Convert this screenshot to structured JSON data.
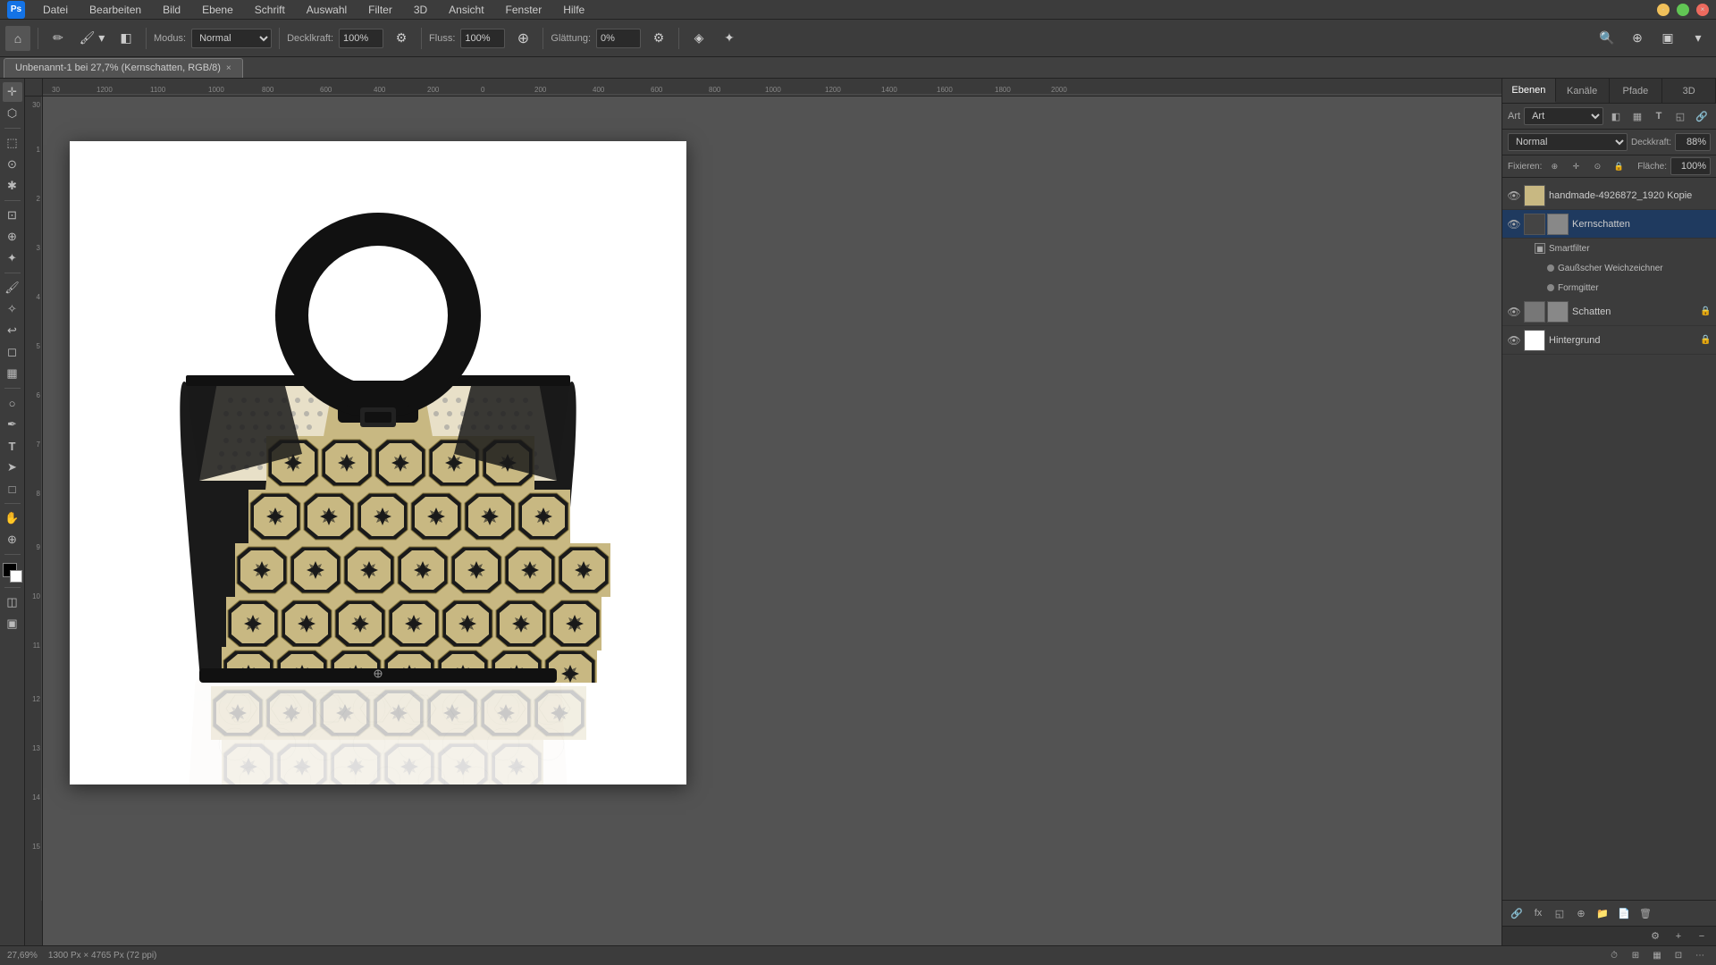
{
  "menubar": {
    "items": [
      "Datei",
      "Bearbeiten",
      "Bild",
      "Ebene",
      "Schrift",
      "Auswahl",
      "Filter",
      "3D",
      "Ansicht",
      "Fenster",
      "Hilfe"
    ]
  },
  "toolbar": {
    "mode_label": "Modus:",
    "mode_value": "Normal",
    "density_label": "Decklkraft:",
    "density_value": "100%",
    "flow_label": "Fluss:",
    "flow_value": "100%",
    "smooth_label": "Glättung:",
    "smooth_value": "0%"
  },
  "tab": {
    "label": "Unbenannt-1 bei 27,7% (Kernschatten, RGB/8)",
    "close": "×"
  },
  "canvas": {
    "ruler_unit": "px",
    "zoom": "27,69%",
    "doc_info": "1300 Px × 4765 Px (72 ppi)"
  },
  "right_panel": {
    "tabs": [
      "Ebenen",
      "Kanäle",
      "Pfade",
      "3D"
    ],
    "active_tab": "Ebenen",
    "art_label": "Art",
    "blend_mode": "Normal",
    "opacity_label": "Deckkraft:",
    "opacity_value": "88%",
    "freeze_label": "Fixieren:",
    "fill_label": "Fläche:",
    "fill_value": "100%",
    "layers": [
      {
        "name": "handmade-4926872_1920 Kopie",
        "visible": true,
        "locked": false,
        "has_thumbnail": true,
        "thumb_color": "#c8b882"
      },
      {
        "name": "Kernschatten",
        "visible": true,
        "locked": false,
        "has_thumbnail": true,
        "thumb_color": "#444",
        "selected": true,
        "smartfilter": {
          "name": "Smartfilter",
          "items": [
            "Gaußscher Weichzeichner",
            "Formgitter"
          ]
        }
      },
      {
        "name": "Schatten",
        "visible": true,
        "locked": true,
        "has_thumbnail": true,
        "thumb_color": "#888"
      },
      {
        "name": "Hintergrund",
        "visible": true,
        "locked": true,
        "has_thumbnail": true,
        "thumb_color": "#fff"
      }
    ],
    "panel_tools": [
      "new-layer",
      "group",
      "fx",
      "mask",
      "adjustment",
      "delete"
    ]
  },
  "statusbar": {
    "zoom": "27,69%",
    "doc_info": "1300 Px × 4765 Px (72 ppi)"
  },
  "icons": {
    "eye": "👁",
    "lock": "🔒",
    "new_layer": "📄",
    "trash": "🗑",
    "search": "🔍"
  }
}
